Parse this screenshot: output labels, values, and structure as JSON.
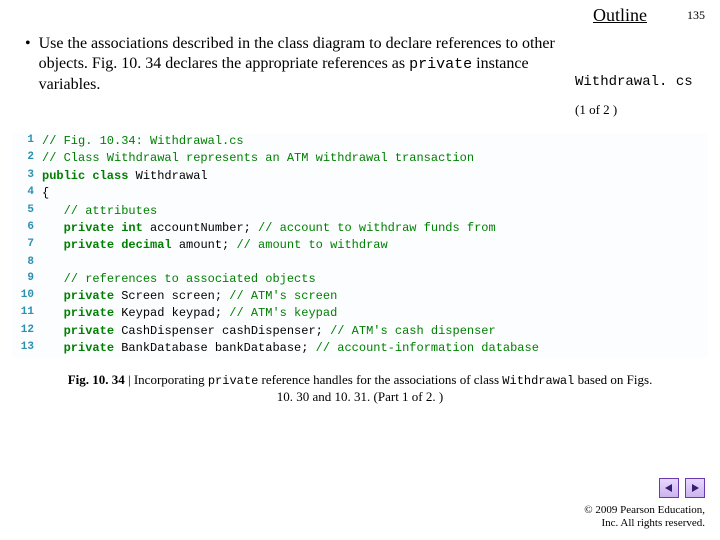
{
  "header": {
    "outline": "Outline",
    "page": "135"
  },
  "bullet": {
    "text_1": "Use the associations described in the class diagram to declare references to other objects. Fig. 10. 34 declares the appropriate references as ",
    "code_word": "private",
    "text_2": " instance variables."
  },
  "aside": {
    "filename": "Withdrawal. cs",
    "part": "(1 of 2 )"
  },
  "code": {
    "lines": [
      {
        "n": "1",
        "segs": [
          [
            "cm",
            "// Fig. 10.34: Withdrawal.cs"
          ]
        ]
      },
      {
        "n": "2",
        "segs": [
          [
            "cm",
            "// Class Withdrawal represents an ATM withdrawal transaction"
          ]
        ]
      },
      {
        "n": "3",
        "segs": [
          [
            "kw",
            "public class"
          ],
          [
            "id",
            " Withdrawal"
          ]
        ]
      },
      {
        "n": "4",
        "segs": [
          [
            "id",
            "{"
          ]
        ]
      },
      {
        "n": "5",
        "segs": [
          [
            "id",
            "   "
          ],
          [
            "cm",
            "// attributes"
          ]
        ]
      },
      {
        "n": "6",
        "segs": [
          [
            "id",
            "   "
          ],
          [
            "kw",
            "private int"
          ],
          [
            "id",
            " accountNumber; "
          ],
          [
            "cm",
            "// account to withdraw funds from"
          ]
        ]
      },
      {
        "n": "7",
        "segs": [
          [
            "id",
            "   "
          ],
          [
            "kw",
            "private decimal"
          ],
          [
            "id",
            " amount; "
          ],
          [
            "cm",
            "// amount to withdraw"
          ]
        ]
      },
      {
        "n": "8",
        "segs": [
          [
            "id",
            ""
          ]
        ]
      },
      {
        "n": "9",
        "segs": [
          [
            "id",
            "   "
          ],
          [
            "cm",
            "// references to associated objects"
          ]
        ]
      },
      {
        "n": "10",
        "segs": [
          [
            "id",
            "   "
          ],
          [
            "kw",
            "private"
          ],
          [
            "id",
            " Screen screen; "
          ],
          [
            "cm",
            "// ATM's screen"
          ]
        ]
      },
      {
        "n": "11",
        "segs": [
          [
            "id",
            "   "
          ],
          [
            "kw",
            "private"
          ],
          [
            "id",
            " Keypad keypad; "
          ],
          [
            "cm",
            "// ATM's keypad"
          ]
        ]
      },
      {
        "n": "12",
        "segs": [
          [
            "id",
            "   "
          ],
          [
            "kw",
            "private"
          ],
          [
            "id",
            " CashDispenser cashDispenser; "
          ],
          [
            "cm",
            "// ATM's cash dispenser"
          ]
        ]
      },
      {
        "n": "13",
        "segs": [
          [
            "id",
            "   "
          ],
          [
            "kw",
            "private"
          ],
          [
            "id",
            " BankDatabase bankDatabase; "
          ],
          [
            "cm",
            "// account-information database"
          ]
        ]
      }
    ]
  },
  "caption": {
    "lead": "Fig. 10. 34",
    "sep": " | Incorporating ",
    "kw1": "private",
    "mid": " reference handles for the associations of class ",
    "kw2": "Withdrawal",
    "tail": " based on Figs. 10. 30 and 10. 31. (Part 1 of 2. )"
  },
  "footer": {
    "line1": "© 2009 Pearson Education,",
    "line2": "Inc. All rights reserved."
  }
}
